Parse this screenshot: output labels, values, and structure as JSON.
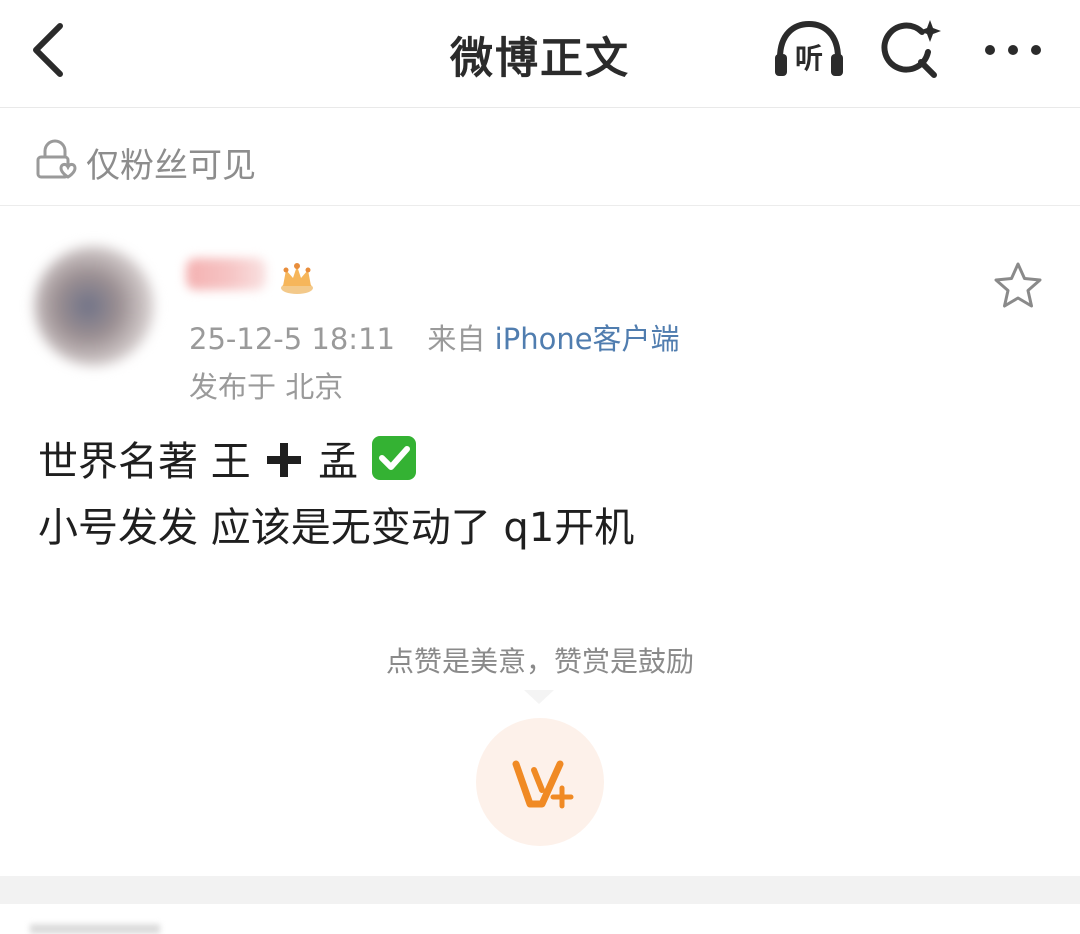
{
  "header": {
    "title": "微博正文",
    "listen_label": "听"
  },
  "visibility": {
    "text": "仅粉丝可见"
  },
  "post": {
    "time": "25-12-5 18:11",
    "from_prefix": "来自",
    "source": "iPhone客户端",
    "location": "发布于 北京",
    "content_line1_a": "世界名著  王",
    "content_line1_b": "孟",
    "content_line2": "小号发发 应该是无变动了 q1开机"
  },
  "reward": {
    "tip": "点赞是美意，赞赏是鼓励"
  },
  "colors": {
    "accent_link": "#507daf",
    "reward_orange": "#f08a24",
    "check_green": "#34b233"
  },
  "icons": [
    "back-arrow-icon",
    "listen-icon",
    "search-sparkle-icon",
    "more-icon",
    "lock-heart-icon",
    "crown-badge-icon",
    "star-icon",
    "plus-icon",
    "check-icon",
    "reward-v-plus-icon"
  ]
}
